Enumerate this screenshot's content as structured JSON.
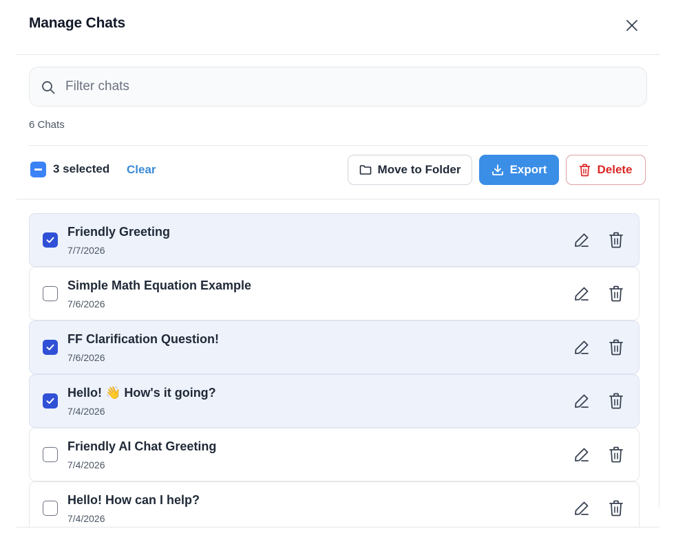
{
  "dialog": {
    "title": "Manage Chats",
    "close_icon": "close-icon"
  },
  "search": {
    "placeholder": "Filter chats",
    "value": "",
    "icon": "search-icon"
  },
  "summary": {
    "count_text": "6 Chats"
  },
  "toolbar": {
    "selected_text": "3 selected",
    "clear_label": "Clear",
    "move_label": "Move to Folder",
    "export_label": "Export",
    "delete_label": "Delete",
    "move_icon": "folder-icon",
    "export_icon": "download-icon",
    "delete_icon": "trash-icon"
  },
  "chats": [
    {
      "title": "Friendly Greeting",
      "date": "7/7/2026",
      "selected": true
    },
    {
      "title": "Simple Math Equation Example",
      "date": "7/6/2026",
      "selected": false
    },
    {
      "title": "FF Clarification Question!",
      "date": "7/6/2026",
      "selected": true
    },
    {
      "title": "Hello! 👋 How's it going?",
      "date": "7/4/2026",
      "selected": true
    },
    {
      "title": "Friendly AI Chat Greeting",
      "date": "7/4/2026",
      "selected": false
    },
    {
      "title": "Hello! How can I help?",
      "date": "7/4/2026",
      "selected": false
    }
  ],
  "colors": {
    "accent": "#3b8ee6",
    "checkbox_checked": "#3050d6",
    "selected_row": "#eef2fb",
    "danger": "#dc2626"
  }
}
